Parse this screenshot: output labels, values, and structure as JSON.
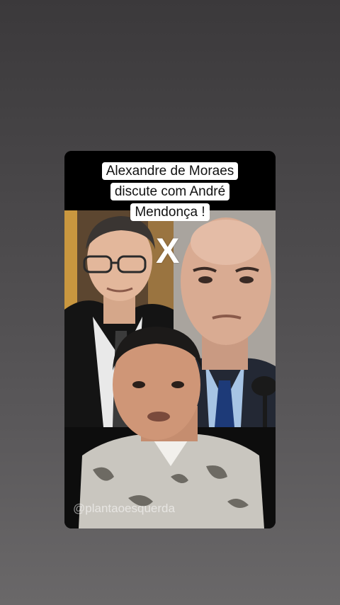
{
  "video": {
    "caption_lines": [
      "Alexandre de Moraes",
      "discute com André",
      "Mendonça !"
    ],
    "versus_mark": "X",
    "watermark": "@plantaoesquerda"
  }
}
